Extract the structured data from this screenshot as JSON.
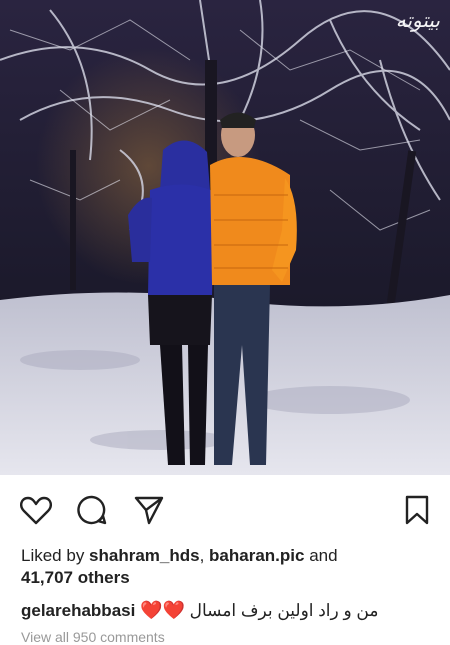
{
  "photo": {
    "watermark": "بیتوته",
    "colors": {
      "sky": "#241f35",
      "snow": "#d9dbe6",
      "orange_jacket": "#f08a1c",
      "blue_jacket": "#2a2fa0"
    }
  },
  "actions": {
    "like_icon": "heart-outline-icon",
    "comment_icon": "comment-bubble-icon",
    "share_icon": "paper-plane-icon",
    "save_icon": "bookmark-icon"
  },
  "likes": {
    "prefix": "Liked by ",
    "user1": "shahram_hds",
    "sep": ", ",
    "user2": "baharan.pic",
    "and": " and",
    "count": "41,707 others"
  },
  "caption": {
    "username": "gelarehabbasi",
    "text": "من و راد اولین برف امسال",
    "emoji": "❤️❤️"
  },
  "more_comments": "View all 950 comments"
}
